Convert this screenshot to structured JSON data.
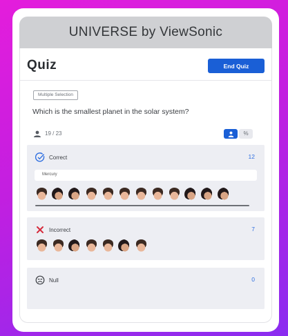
{
  "window": {
    "title": "UNIVERSE by ViewSonic"
  },
  "header": {
    "title": "Quiz",
    "end_button": "End Quiz"
  },
  "question": {
    "type_badge": "Multiple Selection",
    "text": "Which is the smallest planet in the solar system?"
  },
  "responses": {
    "count_text": "19 / 23",
    "view_toggle": [
      "person-icon",
      "%"
    ]
  },
  "cards": {
    "correct": {
      "label": "Correct",
      "count": "12",
      "answer": "Mercury",
      "avatar_count": 12
    },
    "incorrect": {
      "label": "Incorrect",
      "count": "7",
      "avatar_count": 7
    },
    "null": {
      "label": "Null",
      "count": "0",
      "avatar_count": 0
    }
  },
  "colors": {
    "accent": "#1a5fd6",
    "incorrect": "#d62b3c",
    "backdrop_start": "#e41ddc",
    "backdrop_end": "#8a2cf0"
  }
}
